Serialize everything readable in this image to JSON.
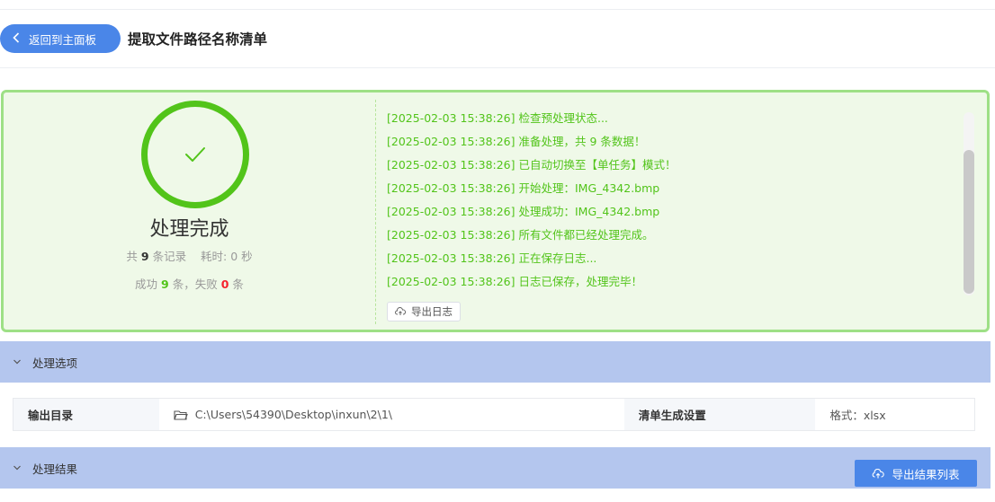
{
  "header": {
    "back_label": "返回到主面板",
    "title": "提取文件路径名称清单"
  },
  "status": {
    "title": "处理完成",
    "summary": {
      "prefix": "共",
      "total": "9",
      "records_label": "条记录",
      "time_label": "耗时:",
      "time_value": "0 秒"
    },
    "result": {
      "success_label": "成功",
      "success_count": "9",
      "unit1": "条，失败",
      "fail_count": "0",
      "unit2": "条"
    }
  },
  "log": {
    "lines": [
      "[2025-02-03 15:38:26] 检查预处理状态...",
      "[2025-02-03 15:38:26] 准备处理，共 9 条数据！",
      "[2025-02-03 15:38:26] 已自动切换至【单任务】模式！",
      "[2025-02-03 15:38:26] 开始处理：IMG_4342.bmp",
      "[2025-02-03 15:38:26] 处理成功：IMG_4342.bmp",
      "[2025-02-03 15:38:26] 所有文件都已经处理完成。",
      "[2025-02-03 15:38:26] 正在保存日志...",
      "[2025-02-03 15:38:26] 日志已保存，处理完毕！"
    ],
    "export_label": "导出日志"
  },
  "options": {
    "section_label": "处理选项",
    "output_dir_label": "输出目录",
    "output_dir_value": "C:\\Users\\54390\\Desktop\\inxun\\2\\1\\",
    "list_settings_label": "清单生成设置",
    "format_value": "格式：xlsx"
  },
  "results": {
    "section_label": "处理结果",
    "export_label": "导出结果列表"
  },
  "colors": {
    "primary": "#4a86e8",
    "success": "#52c41a",
    "fail": "#f5222d",
    "panel_bg": "#eff9e8",
    "panel_border": "#9ee086",
    "section_bg": "#b4c6ee"
  }
}
